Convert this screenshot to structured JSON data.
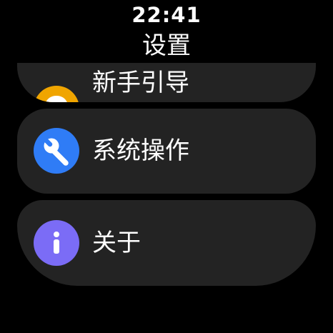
{
  "status": {
    "time": "22:41"
  },
  "header": {
    "title": "设置"
  },
  "menu": {
    "items": [
      {
        "label": "新手引导",
        "icon": "lightbulb-icon",
        "icon_color": "#f0a500"
      },
      {
        "label": "系统操作",
        "icon": "wrench-icon",
        "icon_color": "#2f7cf6"
      },
      {
        "label": "关于",
        "icon": "info-icon",
        "icon_color": "#7b6cf6"
      }
    ]
  }
}
